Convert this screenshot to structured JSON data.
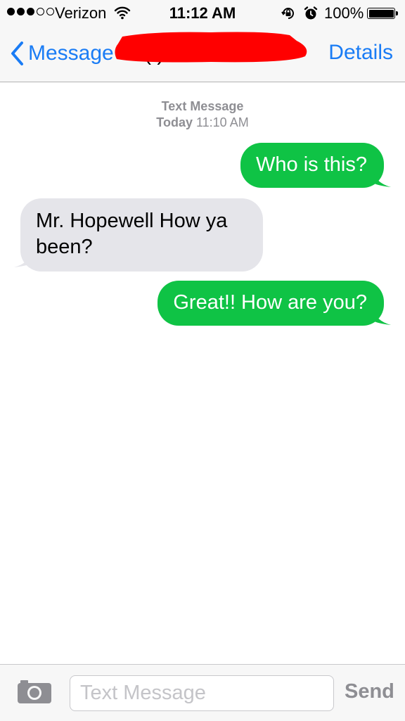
{
  "status_bar": {
    "signal_bars_filled": 3,
    "signal_bars_total": 5,
    "carrier": "Verizon",
    "time": "11:12 AM",
    "battery_percent": "100%",
    "icons": [
      "wifi-icon",
      "rotation-lock-icon",
      "alarm-icon",
      "battery-icon"
    ]
  },
  "nav": {
    "back_label": "Message",
    "contact_visible": "(   )",
    "details_label": "Details",
    "redaction_color": "#ff0000"
  },
  "thread": {
    "service_label": "Text Message",
    "day_label": "Today",
    "time_label": "11:10 AM"
  },
  "messages": [
    {
      "direction": "sent",
      "text": "Who is this?"
    },
    {
      "direction": "received",
      "text": "Mr. Hopewell How ya been?"
    },
    {
      "direction": "sent",
      "text": "Great!! How are you?"
    }
  ],
  "input_bar": {
    "placeholder": "Text Message",
    "value": "",
    "send_label": "Send"
  },
  "colors": {
    "accent": "#1a7cf5",
    "sent_bubble": "#0fc345",
    "received_bubble": "#e5e5ea",
    "bar_background": "#f7f7f7"
  }
}
